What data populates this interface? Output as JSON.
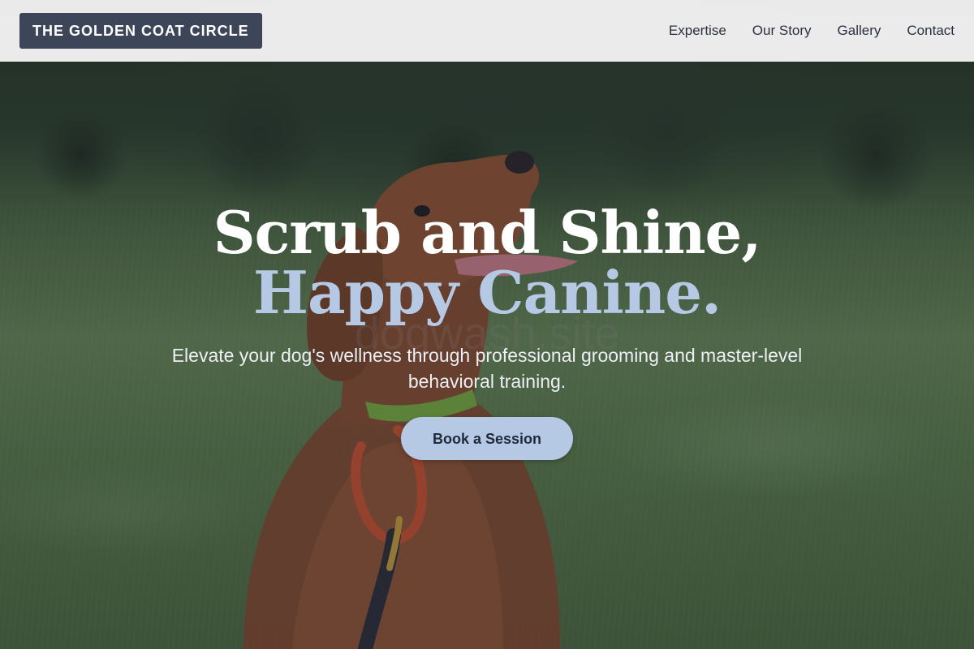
{
  "brand": {
    "logo_text": "THE GOLDEN COAT CIRCLE"
  },
  "nav": {
    "items": [
      {
        "label": "Expertise"
      },
      {
        "label": "Our Story"
      },
      {
        "label": "Gallery"
      },
      {
        "label": "Contact"
      }
    ]
  },
  "hero": {
    "title_line1": "Scrub and Shine,",
    "title_line2": "Happy Canine.",
    "watermark": "dogwash.site",
    "subtitle": "Elevate your dog's wellness through professional grooming and master-level behavioral training.",
    "cta_label": "Book a Session",
    "image_icon": "dog-photo"
  },
  "colors": {
    "header_bg": "#f3f3f3",
    "logo_bg": "#3d4658",
    "accent": "#b5c8e4",
    "nav_text": "#2b3140"
  }
}
